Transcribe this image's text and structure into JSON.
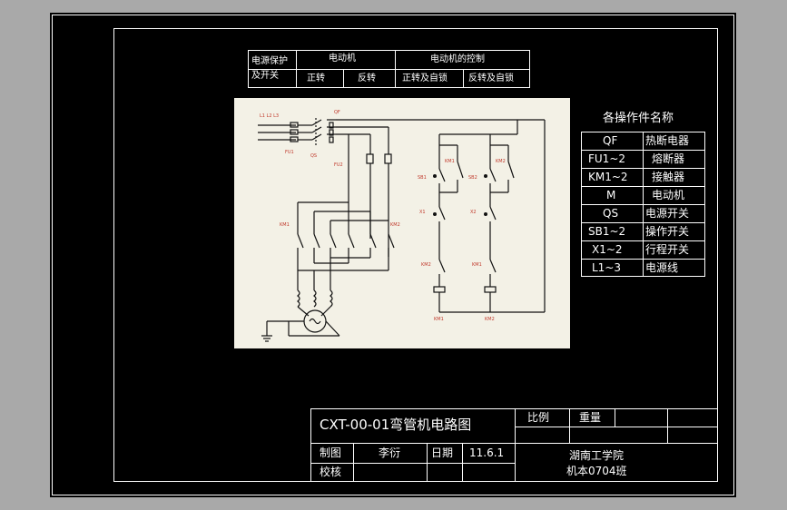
{
  "header_table": {
    "col1_line1": "电源保护",
    "col1_line2": "及开关",
    "motor_title": "电动机",
    "motor_forward": "正转",
    "motor_reverse": "反转",
    "control_title": "电动机的控制",
    "control_forward": "正转及自锁",
    "control_reverse": "反转及自锁"
  },
  "parts_table": {
    "title": "各操作件名称",
    "rows": [
      {
        "code": "QF",
        "name": "热断电器"
      },
      {
        "code": "FU1~2",
        "name": "熔断器"
      },
      {
        "code": "KM1~2",
        "name": "接触器"
      },
      {
        "code": "M",
        "name": "电动机"
      },
      {
        "code": "QS",
        "name": "电源开关"
      },
      {
        "code": "SB1~2",
        "name": "操作开关"
      },
      {
        "code": "X1~2",
        "name": "行程开关"
      },
      {
        "code": "L1~3",
        "name": "电源线"
      }
    ]
  },
  "diagram_labels": {
    "l123": "L1 L2 L3",
    "qf": "QF",
    "qs": "QS",
    "fu1": "FU1",
    "fu2": "FU2",
    "km1_left": "KM1",
    "km2_left": "KM2",
    "km1_ctrl": "KM1",
    "km2_ctrl": "KM2",
    "sb1": "SB1",
    "sb2": "SB2",
    "x1": "X1",
    "x2": "X2",
    "km1_coil": "KM1",
    "km2_coil": "KM2",
    "km2_sw": "KM2",
    "km1_sw": "KM1"
  },
  "title_block": {
    "drawing_title": "CXT-00-01弯管机电路图",
    "scale_label": "比例",
    "weight_label": "重量",
    "drawn_label": "制图",
    "drawn_by": "李衍",
    "date_label": "日期",
    "date_value": "11.6.1",
    "check_label": "校核",
    "school": "湖南工学院",
    "class_name": "机本0704班"
  },
  "colors": {
    "frame_bg": "#000000",
    "page_bg": "#a9a9a9",
    "diagram_bg": "#f3f1e6",
    "diagram_label": "#c0392b"
  }
}
